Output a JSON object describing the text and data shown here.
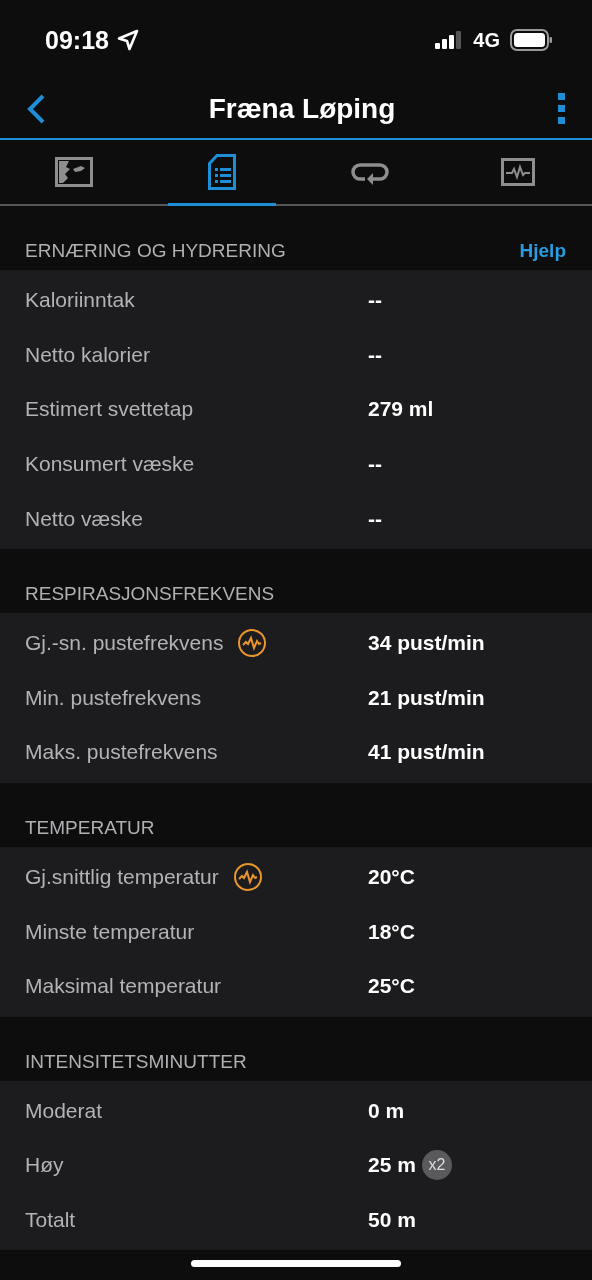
{
  "status_bar": {
    "time": "09:18",
    "network": "4G"
  },
  "header": {
    "title": "Fræna Løping"
  },
  "tabs": [
    {
      "kind": "map",
      "selected": false
    },
    {
      "kind": "details",
      "selected": true
    },
    {
      "kind": "laps",
      "selected": false
    },
    {
      "kind": "graph",
      "selected": false
    }
  ],
  "sections": [
    {
      "title": "ERNÆRING OG HYDRERING",
      "link": "Hjelp",
      "rows": [
        {
          "label": "Kaloriinntak",
          "value": "--"
        },
        {
          "label": "Netto kalorier",
          "value": "--"
        },
        {
          "label": "Estimert svettetap",
          "value": "279 ml"
        },
        {
          "label": "Konsumert væske",
          "value": "--"
        },
        {
          "label": "Netto væske",
          "value": "--"
        }
      ]
    },
    {
      "title": "RESPIRASJONSFREKVENS",
      "rows": [
        {
          "label": "Gj.-sn. pustefrekvens",
          "value": "34 pust/min",
          "chart_link": true
        },
        {
          "label": "Min. pustefrekvens",
          "value": "21 pust/min"
        },
        {
          "label": "Maks. pustefrekvens",
          "value": "41 pust/min"
        }
      ]
    },
    {
      "title": "TEMPERATUR",
      "rows": [
        {
          "label": "Gj.snittlig temperatur",
          "value": "20°C",
          "chart_link": true
        },
        {
          "label": "Minste temperatur",
          "value": "18°C"
        },
        {
          "label": "Maksimal temperatur",
          "value": "25°C"
        }
      ]
    },
    {
      "title": "INTENSITETSMINUTTER",
      "rows": [
        {
          "label": "Moderat",
          "value": "0 m"
        },
        {
          "label": "Høy",
          "value": "25 m",
          "badge": "x2"
        },
        {
          "label": "Totalt",
          "value": "50 m"
        }
      ]
    }
  ]
}
